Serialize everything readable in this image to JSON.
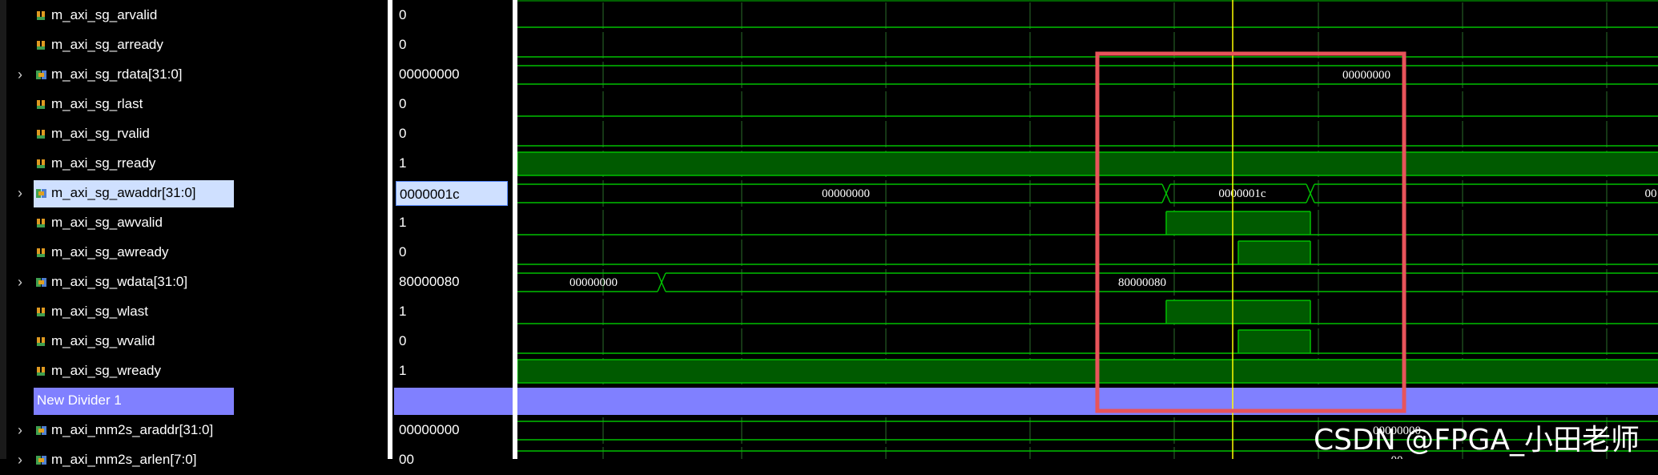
{
  "signals": [
    {
      "name": "m_axi_sg_arvalid",
      "value": "0",
      "type": "bit",
      "expandable": false
    },
    {
      "name": "m_axi_sg_arready",
      "value": "0",
      "type": "bit",
      "expandable": false
    },
    {
      "name": "m_axi_sg_rdata[31:0]",
      "value": "00000000",
      "type": "bus",
      "expandable": true
    },
    {
      "name": "m_axi_sg_rlast",
      "value": "0",
      "type": "bit",
      "expandable": false
    },
    {
      "name": "m_axi_sg_rvalid",
      "value": "0",
      "type": "bit",
      "expandable": false
    },
    {
      "name": "m_axi_sg_rready",
      "value": "1",
      "type": "bit",
      "expandable": false
    },
    {
      "name": "m_axi_sg_awaddr[31:0]",
      "value": "0000001c",
      "type": "bus",
      "expandable": true,
      "selected": true
    },
    {
      "name": "m_axi_sg_awvalid",
      "value": "1",
      "type": "bit",
      "expandable": false
    },
    {
      "name": "m_axi_sg_awready",
      "value": "0",
      "type": "bit",
      "expandable": false
    },
    {
      "name": "m_axi_sg_wdata[31:0]",
      "value": "80000080",
      "type": "bus",
      "expandable": true
    },
    {
      "name": "m_axi_sg_wlast",
      "value": "1",
      "type": "bit",
      "expandable": false
    },
    {
      "name": "m_axi_sg_wvalid",
      "value": "0",
      "type": "bit",
      "expandable": false
    },
    {
      "name": "m_axi_sg_wready",
      "value": "1",
      "type": "bit",
      "expandable": false
    },
    {
      "name": "New Divider 1",
      "value": "",
      "type": "divider",
      "expandable": false
    },
    {
      "name": "m_axi_mm2s_araddr[31:0]",
      "value": "00000000",
      "type": "bus",
      "expandable": true
    },
    {
      "name": "m_axi_mm2s_arlen[7:0]",
      "value": "00",
      "type": "bus",
      "expandable": true
    }
  ],
  "wave_labels": {
    "rdata": "00000000",
    "awaddr_before": "00000000",
    "awaddr_mid": "0000001c",
    "awaddr_after": "00",
    "wdata_before": "00000000",
    "wdata_after": "80000080",
    "mm2s_araddr": "00000000",
    "mm2s_arlen": "00"
  },
  "colors": {
    "wave_line": "#00c000",
    "wave_fill": "#005a00",
    "grid": "#2a6e2a",
    "cursor": "#ffff00",
    "divider": "#8080ff",
    "highlight_box": "#e8545a"
  },
  "watermark": "CSDN @FPGA_小田老师"
}
